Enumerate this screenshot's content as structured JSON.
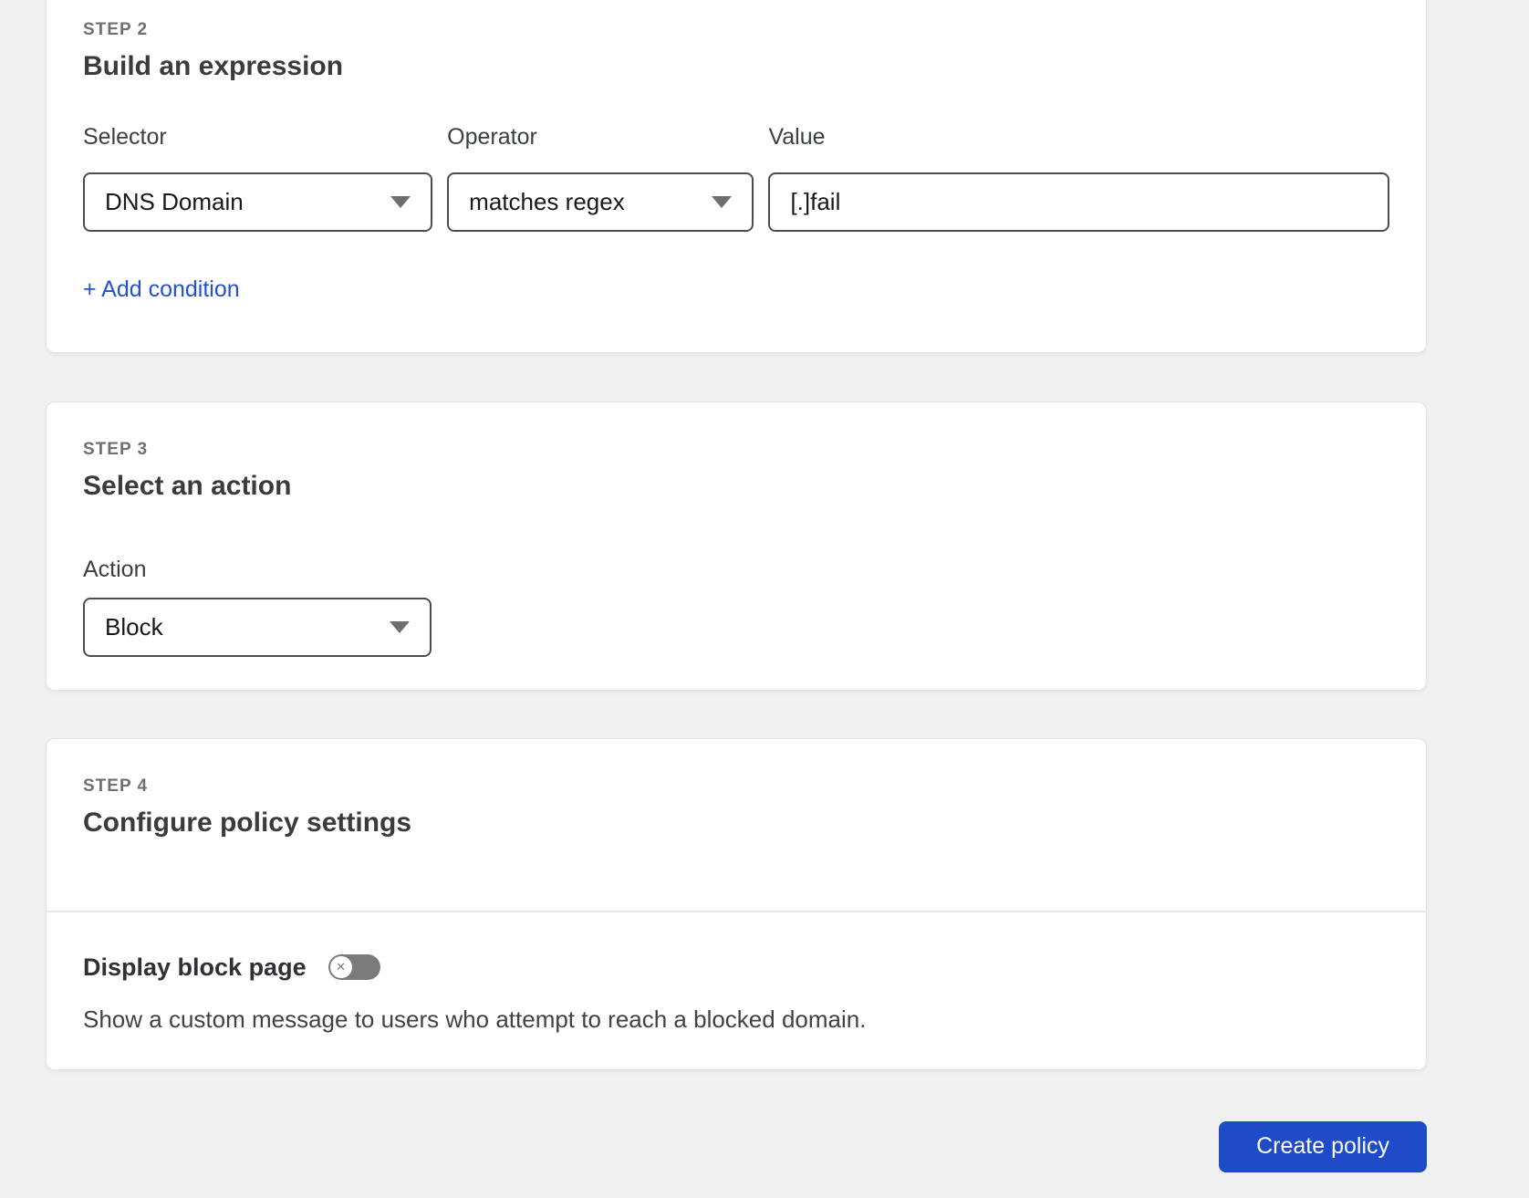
{
  "colors": {
    "page_bg": "#f1f1f2",
    "card_bg": "#ffffff",
    "link_blue": "#2151d5",
    "button_blue": "#1e4bc8",
    "toggle_off_gray": "#7b7b7b",
    "border_dark": "#4d4d4d"
  },
  "step2": {
    "step_label": "STEP 2",
    "title": "Build an expression",
    "selector": {
      "label": "Selector",
      "value": "DNS Domain"
    },
    "operator": {
      "label": "Operator",
      "value": "matches regex"
    },
    "value": {
      "label": "Value",
      "text": "[.]fail"
    },
    "add_condition": "+ Add condition"
  },
  "step3": {
    "step_label": "STEP 3",
    "title": "Select an action",
    "action": {
      "label": "Action",
      "value": "Block"
    }
  },
  "step4": {
    "step_label": "STEP 4",
    "title": "Configure policy settings",
    "block_page": {
      "label": "Display block page",
      "state": "off",
      "knob_glyph": "✕",
      "description": "Show a custom message to users who attempt to reach a blocked domain."
    }
  },
  "footer": {
    "create_button": "Create policy"
  }
}
